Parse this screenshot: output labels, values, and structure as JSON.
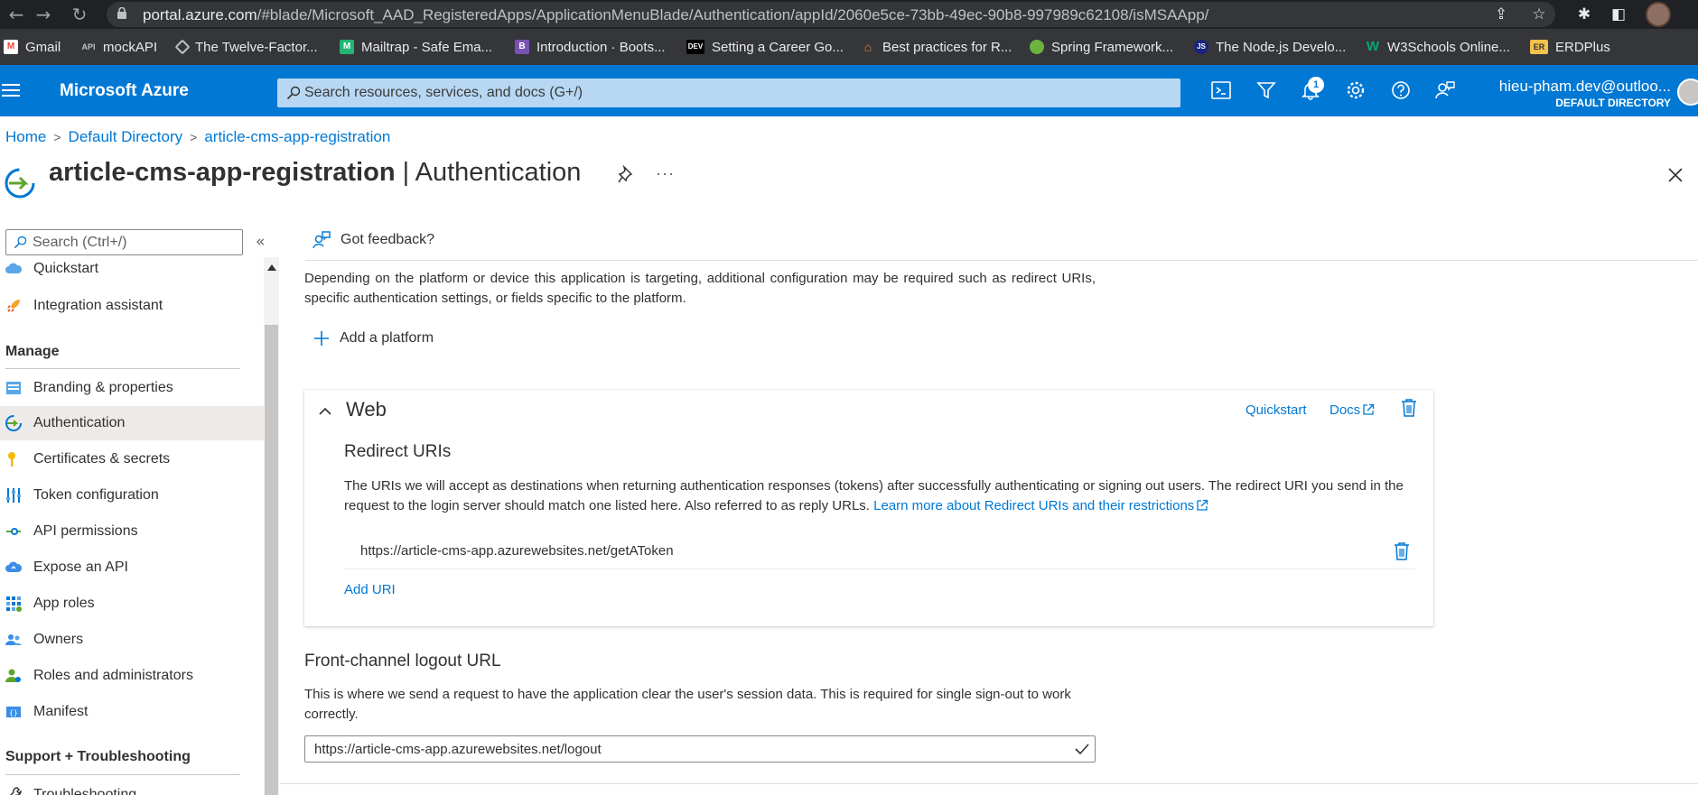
{
  "browser": {
    "url_domain": "portal.azure.com",
    "url_path": "/#blade/Microsoft_AAD_RegisteredApps/ApplicationMenuBlade/Authentication/appId/2060e5ce-73bb-49ec-90b8-997989c62108/isMSAApp/",
    "bookmarks": [
      {
        "label": "Gmail",
        "icon": "gmail-icon",
        "color": "#ea4335",
        "glyph": "M"
      },
      {
        "label": "mockAPI",
        "icon": "mockapi-icon",
        "color": "#5f6368",
        "glyph": "m"
      },
      {
        "label": "The Twelve-Factor...",
        "icon": "twelve-factor-icon",
        "color": "#9aa0a6",
        "glyph": "◇"
      },
      {
        "label": "Mailtrap - Safe Ema...",
        "icon": "mailtrap-icon",
        "color": "#22b573",
        "glyph": "M"
      },
      {
        "label": "Introduction · Boots...",
        "icon": "bootstrap-icon",
        "color": "#7952b3",
        "glyph": "B"
      },
      {
        "label": "Setting a Career Go...",
        "icon": "dev-icon",
        "color": "#000000",
        "glyph": "DEV"
      },
      {
        "label": "Best practices for R...",
        "icon": "stackoverflow-icon",
        "color": "#f48024",
        "glyph": "S"
      },
      {
        "label": "Spring Framework...",
        "icon": "spring-icon",
        "color": "#6db33f",
        "glyph": "S"
      },
      {
        "label": "The Node.js Develo...",
        "icon": "nodejs-icon",
        "color": "#1a73e8",
        "glyph": "JS"
      },
      {
        "label": "W3Schools Online...",
        "icon": "w3schools-icon",
        "color": "#04aa6d",
        "glyph": "W"
      },
      {
        "label": "ERDPlus",
        "icon": "erdplus-icon",
        "color": "#f2c14e",
        "glyph": "ER"
      }
    ]
  },
  "header": {
    "brand": "Microsoft Azure",
    "search_placeholder": "Search resources, services, and docs (G+/)",
    "notification_count": "1",
    "account_name": "hieu-pham.dev@outloo...",
    "account_directory": "DEFAULT DIRECTORY"
  },
  "breadcrumb": [
    "Home",
    "Default Directory",
    "article-cms-app-registration"
  ],
  "page": {
    "title_app": "article-cms-app-registration",
    "title_sep": " | ",
    "title_section": "Authentication"
  },
  "sidebar": {
    "search_placeholder": "Search (Ctrl+/)",
    "items_top": [
      {
        "label": "Quickstart",
        "icon": "quickstart-cloud-icon"
      },
      {
        "label": "Integration assistant",
        "icon": "rocket-icon"
      }
    ],
    "section_manage": "Manage",
    "items_manage": [
      {
        "label": "Branding & properties",
        "icon": "branding-icon"
      },
      {
        "label": "Authentication",
        "icon": "authentication-icon",
        "selected": true
      },
      {
        "label": "Certificates & secrets",
        "icon": "key-icon"
      },
      {
        "label": "Token configuration",
        "icon": "token-config-icon"
      },
      {
        "label": "API permissions",
        "icon": "api-permissions-icon"
      },
      {
        "label": "Expose an API",
        "icon": "expose-api-cloud-icon"
      },
      {
        "label": "App roles",
        "icon": "app-roles-icon"
      },
      {
        "label": "Owners",
        "icon": "owners-icon"
      },
      {
        "label": "Roles and administrators",
        "icon": "roles-admins-icon"
      },
      {
        "label": "Manifest",
        "icon": "manifest-icon"
      }
    ],
    "section_support": "Support + Troubleshooting",
    "item_partial": "Troubleshooting"
  },
  "main": {
    "feedback": "Got feedback?",
    "description": "Depending on the platform or device this application is targeting, additional configuration may be required such as redirect URIs, specific authentication settings, or fields specific to the platform.",
    "add_platform": "Add a platform",
    "web_card": {
      "title": "Web",
      "quickstart_link": "Quickstart",
      "docs_link": "Docs",
      "redirect_heading": "Redirect URIs",
      "redirect_desc": "The URIs we will accept as destinations when returning authentication responses (tokens) after successfully authenticating or signing out users. The redirect URI you send in the request to the login server should match one listed here. Also referred to as reply URLs. ",
      "redirect_learn_more": "Learn more about Redirect URIs and their restrictions",
      "redirect_uri": "https://article-cms-app.azurewebsites.net/getAToken",
      "add_uri": "Add URI"
    },
    "front_channel": {
      "heading": "Front-channel logout URL",
      "desc": "This is where we send a request to have the application clear the user's session data. This is required for single sign-out to work correctly.",
      "value": "https://article-cms-app.azurewebsites.net/logout"
    }
  },
  "colors": {
    "accent": "#0078d4",
    "browser_bg": "#202124",
    "selected_nav": "#edebe9"
  }
}
